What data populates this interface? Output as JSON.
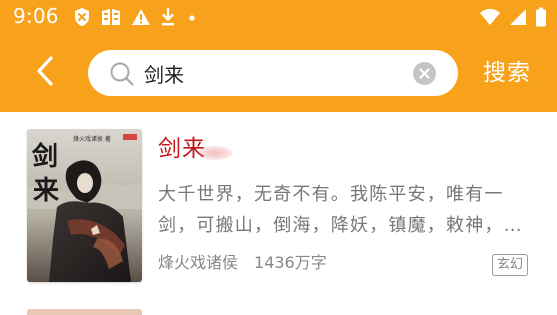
{
  "status_bar": {
    "time": "9:06",
    "left_icons": [
      "shield-icon",
      "book-app-icon",
      "warning-icon",
      "download-icon",
      "dot-icon"
    ],
    "right_icons": [
      "wifi-icon",
      "signal-icon",
      "battery-icon"
    ]
  },
  "colors": {
    "accent": "#f7a21a",
    "title_red": "#c0171b",
    "text_gray": "#777777"
  },
  "toolbar": {
    "back_icon": "chevron-left-icon",
    "search": {
      "value": "剑来",
      "icon": "search-icon",
      "clear_icon": "clear-circle-icon"
    },
    "submit_label": "搜索"
  },
  "results": [
    {
      "cover_text": "剑来",
      "cover_small": "烽火戏诸侯 著",
      "title": "剑来",
      "description": "大千世界，无奇不有。我陈平安，唯有一剑，可搬山，倒海，降妖，镇魔，敕神，…",
      "author": "烽火戏诸侯",
      "word_count": "1436万字",
      "genre": "玄幻"
    }
  ]
}
